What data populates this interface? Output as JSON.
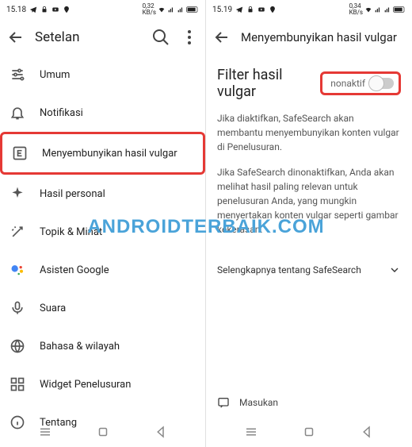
{
  "left": {
    "statusbar": {
      "time": "15.18",
      "speed_value": "0,32",
      "speed_unit": "KB/s"
    },
    "appbar": {
      "title": "Setelan"
    },
    "items": [
      {
        "name": "umum",
        "label": "Umum",
        "icon": "tune"
      },
      {
        "name": "notifikasi",
        "label": "Notifikasi",
        "icon": "bell"
      },
      {
        "name": "menyembunyikan",
        "label": "Menyembunyikan hasil vulgar",
        "icon": "explicit",
        "highlighted": true
      },
      {
        "name": "hasil-personal",
        "label": "Hasil personal",
        "icon": "sparkle"
      },
      {
        "name": "topik-minat",
        "label": "Topik & Minat",
        "icon": "wand"
      },
      {
        "name": "asisten-google",
        "label": "Asisten Google",
        "icon": "assistant"
      },
      {
        "name": "suara",
        "label": "Suara",
        "icon": "mic"
      },
      {
        "name": "bahasa-wilayah",
        "label": "Bahasa & wilayah",
        "icon": "globe"
      },
      {
        "name": "widget-penelusuran",
        "label": "Widget Penelusuran",
        "icon": "widgets"
      },
      {
        "name": "tentang",
        "label": "Tentang",
        "icon": "info"
      }
    ]
  },
  "right": {
    "statusbar": {
      "time": "15.19",
      "speed_value": "0,34",
      "speed_unit": "KB/s"
    },
    "appbar": {
      "title": "Menyembunyikan hasil vulgar"
    },
    "filter": {
      "title": "Filter hasil vulgar",
      "toggle_label": "nonaktif",
      "toggle_on": false
    },
    "para1": "Jika diaktifkan, SafeSearch akan membantu menyembunyikan konten vulgar di Penelusuran.",
    "para2": "Jika SafeSearch dinonaktifkan, Anda akan melihat hasil paling relevan untuk penelusuran Anda, yang mungkin menyertakan konten vulgar seperti gambar kekerasan.",
    "expand": "Selengkapnya tentang SafeSearch",
    "feedback": "Masukan"
  },
  "watermark": "ANDROIDTERBAIK.COM"
}
